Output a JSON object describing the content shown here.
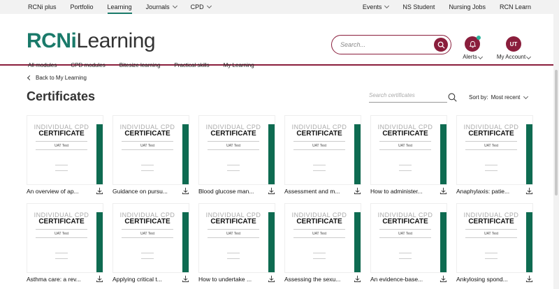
{
  "topnav": {
    "left": [
      {
        "label": "RCNi plus"
      },
      {
        "label": "Portfolio"
      },
      {
        "label": "Learning"
      },
      {
        "label": "Journals"
      },
      {
        "label": "CPD"
      }
    ],
    "right": [
      {
        "label": "Events"
      },
      {
        "label": "NS Student"
      },
      {
        "label": "Nursing Jobs"
      },
      {
        "label": "RCN Learn"
      }
    ]
  },
  "logo": {
    "rcni": "RCNi",
    "learning": "Learning"
  },
  "search": {
    "placeholder": "Search..."
  },
  "alerts": {
    "label": "Alerts"
  },
  "account": {
    "initials": "UT",
    "label": "My Account"
  },
  "subnav": [
    "All modules",
    "CPD modules",
    "Bitesize learning",
    "Practical skills",
    "My Learning"
  ],
  "back": "Back to My Learning",
  "page_title": "Certificates",
  "cert_search": {
    "placeholder": "Search certificates"
  },
  "sort": {
    "label": "Sort by:",
    "value": "Most recent"
  },
  "cert_template": {
    "head1": "INDIVIDUAL CPD",
    "head2": "CERTIFICATE",
    "name": "UAT Test"
  },
  "colors": {
    "brand": "#8a1e3c",
    "green": "#0e6b51",
    "teal": "#1a7a6a"
  },
  "certificates": [
    {
      "title": "An overview of ap..."
    },
    {
      "title": "Guidance on pursu..."
    },
    {
      "title": "Blood glucose man..."
    },
    {
      "title": "Assessment and m..."
    },
    {
      "title": "How to administer..."
    },
    {
      "title": "Anaphylaxis: patie..."
    },
    {
      "title": "Asthma care: a rev..."
    },
    {
      "title": "Applying critical t..."
    },
    {
      "title": "How to undertake ..."
    },
    {
      "title": "Assessing the sexu..."
    },
    {
      "title": "An evidence-base..."
    },
    {
      "title": "Ankylosing spond..."
    }
  ]
}
